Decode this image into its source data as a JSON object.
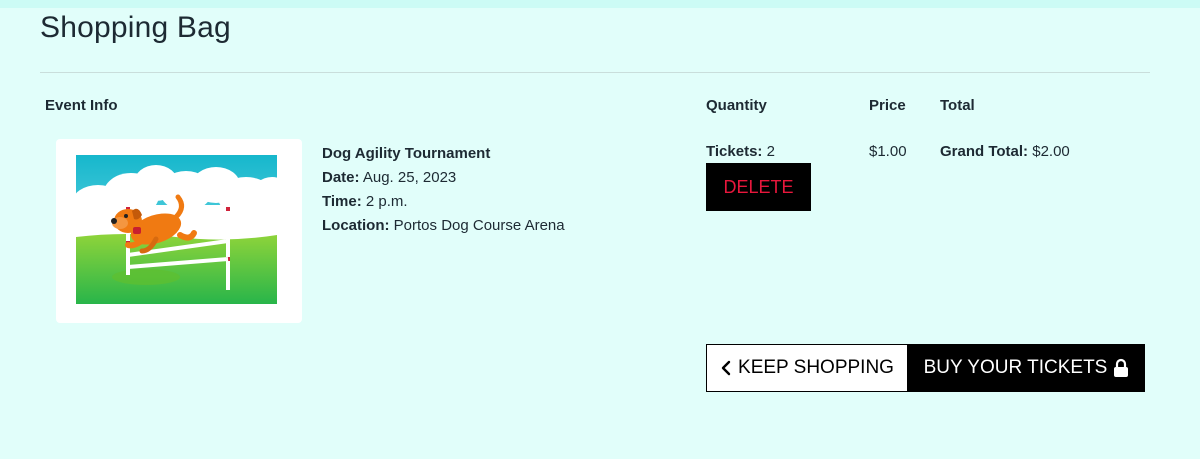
{
  "page": {
    "title": "Shopping Bag"
  },
  "table": {
    "headers": {
      "event_info": "Event Info",
      "quantity": "Quantity",
      "price": "Price",
      "total": "Total"
    }
  },
  "item": {
    "image_icon": "dog-agility-image",
    "name": "Dog Agility Tournament",
    "date_label": "Date:",
    "date_value": "Aug. 25, 2023",
    "time_label": "Time:",
    "time_value": "2 p.m.",
    "location_label": "Location:",
    "location_value": "Portos Dog Course Arena",
    "tickets_label": "Tickets:",
    "tickets_value": "2",
    "delete_label": "DELETE",
    "price": "$1.00"
  },
  "summary": {
    "grand_total_label": "Grand Total:",
    "grand_total_value": "$2.00"
  },
  "actions": {
    "keep_shopping_label": "KEEP SHOPPING",
    "keep_shopping_icon": "chevron-left-icon",
    "buy_label": "BUY YOUR TICKETS",
    "buy_icon": "lock-icon"
  },
  "colors": {
    "background": "#e1fefa",
    "delete_text": "#e8173c",
    "button_dark": "#000000"
  }
}
